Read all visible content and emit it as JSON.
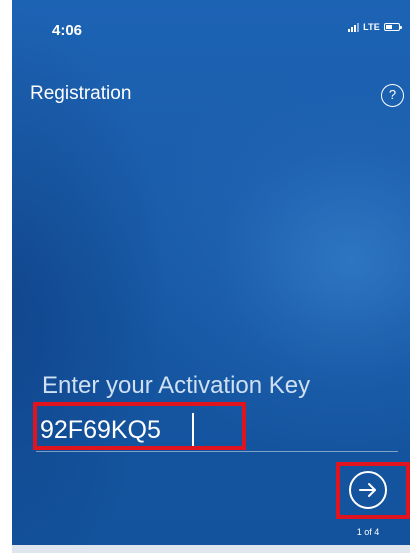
{
  "status_bar": {
    "time": "4:06",
    "network": "LTE",
    "signal_icon": "signal-bars-icon",
    "battery_icon": "battery-icon"
  },
  "header": {
    "title": "Registration",
    "help_label": "?",
    "help_icon": "help-circle-icon"
  },
  "activation": {
    "label": "Enter your Activation Key",
    "key_value": "92F69KQ5"
  },
  "navigation": {
    "next_icon": "arrow-right-circle-icon",
    "step_indicator": "1 of 4"
  },
  "colors": {
    "background": "#1a5dab",
    "highlight": "#e0141e",
    "text": "#ffffff"
  }
}
